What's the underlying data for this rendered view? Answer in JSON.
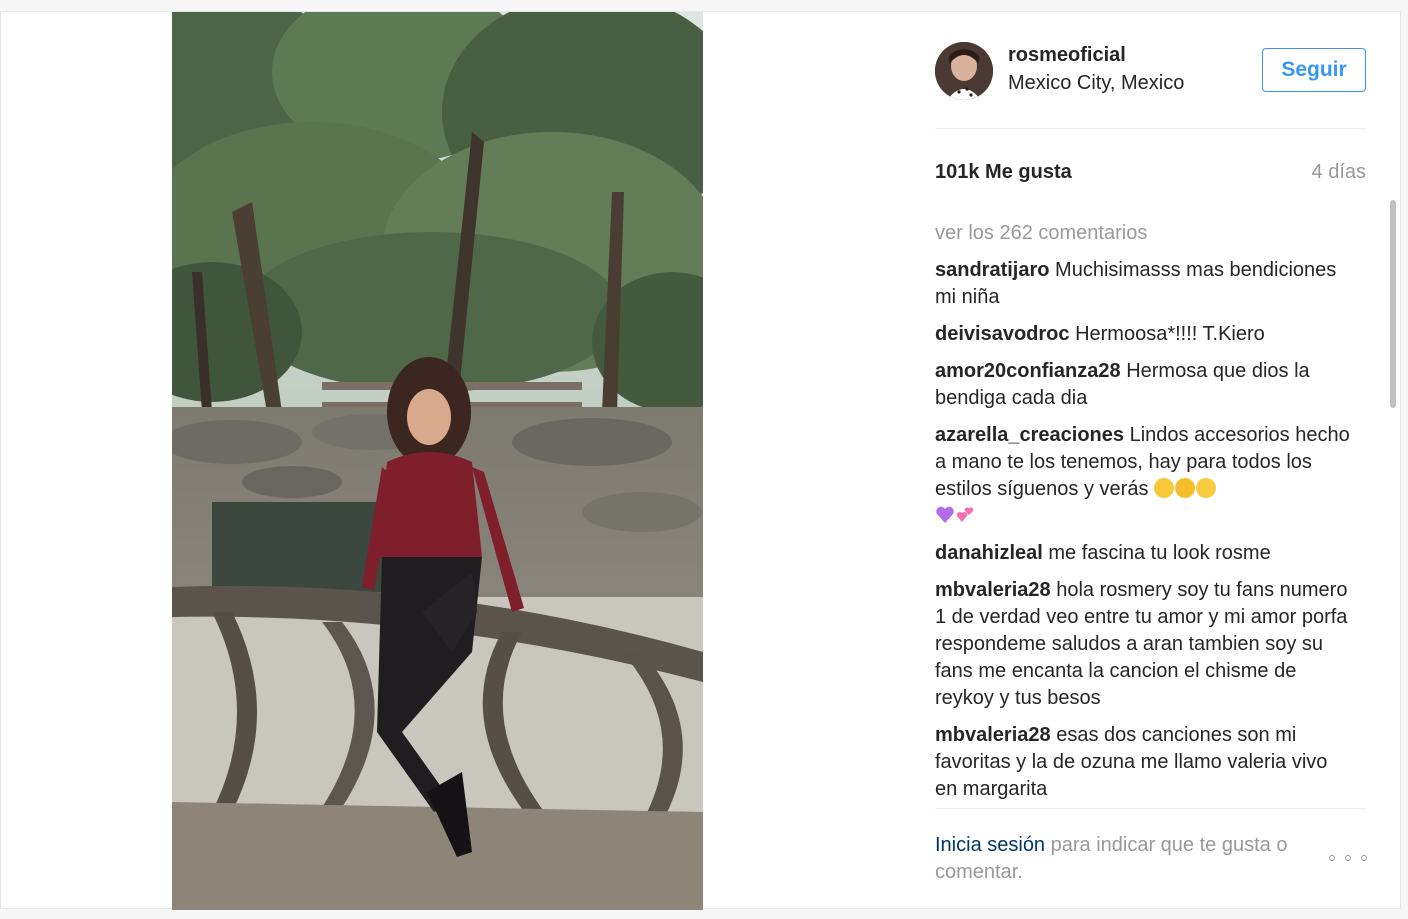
{
  "post": {
    "image_alt": "",
    "username": "rosmeoficial",
    "location": "Mexico City, Mexico",
    "follow_label": "Seguir",
    "likes": "101k Me gusta",
    "time_ago": "4 días",
    "view_all_comments": "ver los 262 comentarios",
    "comments": [
      {
        "author": "sandratijaro",
        "text": "Muchisimasss mas bendiciones mi niña"
      },
      {
        "author": "deivisavodroc",
        "text": "Hermoosa*!!!! T.Kiero"
      },
      {
        "author": "amor20confianza28",
        "text": "Hermosa que dios la bendiga cada dia"
      },
      {
        "author": "azarella_creaciones",
        "text": "Lindos accesorios hecho a mano te los tenemos, hay para todos los estilos síguenos y verás"
      },
      {
        "author": "danahizleal",
        "text": "me fascina tu look rosme"
      },
      {
        "author": "mbvaleria28",
        "text": "hola rosmery soy tu fans numero 1 de verdad veo entre tu amor y mi amor porfa respondeme saludos a aran tambien soy su fans me encanta la cancion el chisme de reykoy y tus besos"
      },
      {
        "author": "mbvaleria28",
        "text": "esas dos canciones son mi favoritas y la de ozuna me llamo valeria vivo en margarita"
      }
    ],
    "login_link": "Inicia sesión",
    "login_rest": "para indicar que te gusta o comentar."
  },
  "icons": {
    "more": "more-options-icon",
    "emoji_row": [
      "grinning-face-icon",
      "laughing-face-icon",
      "winking-face-icon",
      "purple-heart-icon",
      "two-hearts-icon"
    ]
  },
  "colors": {
    "accent": "#3897f0",
    "link": "#003569",
    "muted": "#999999",
    "text": "#262626"
  }
}
